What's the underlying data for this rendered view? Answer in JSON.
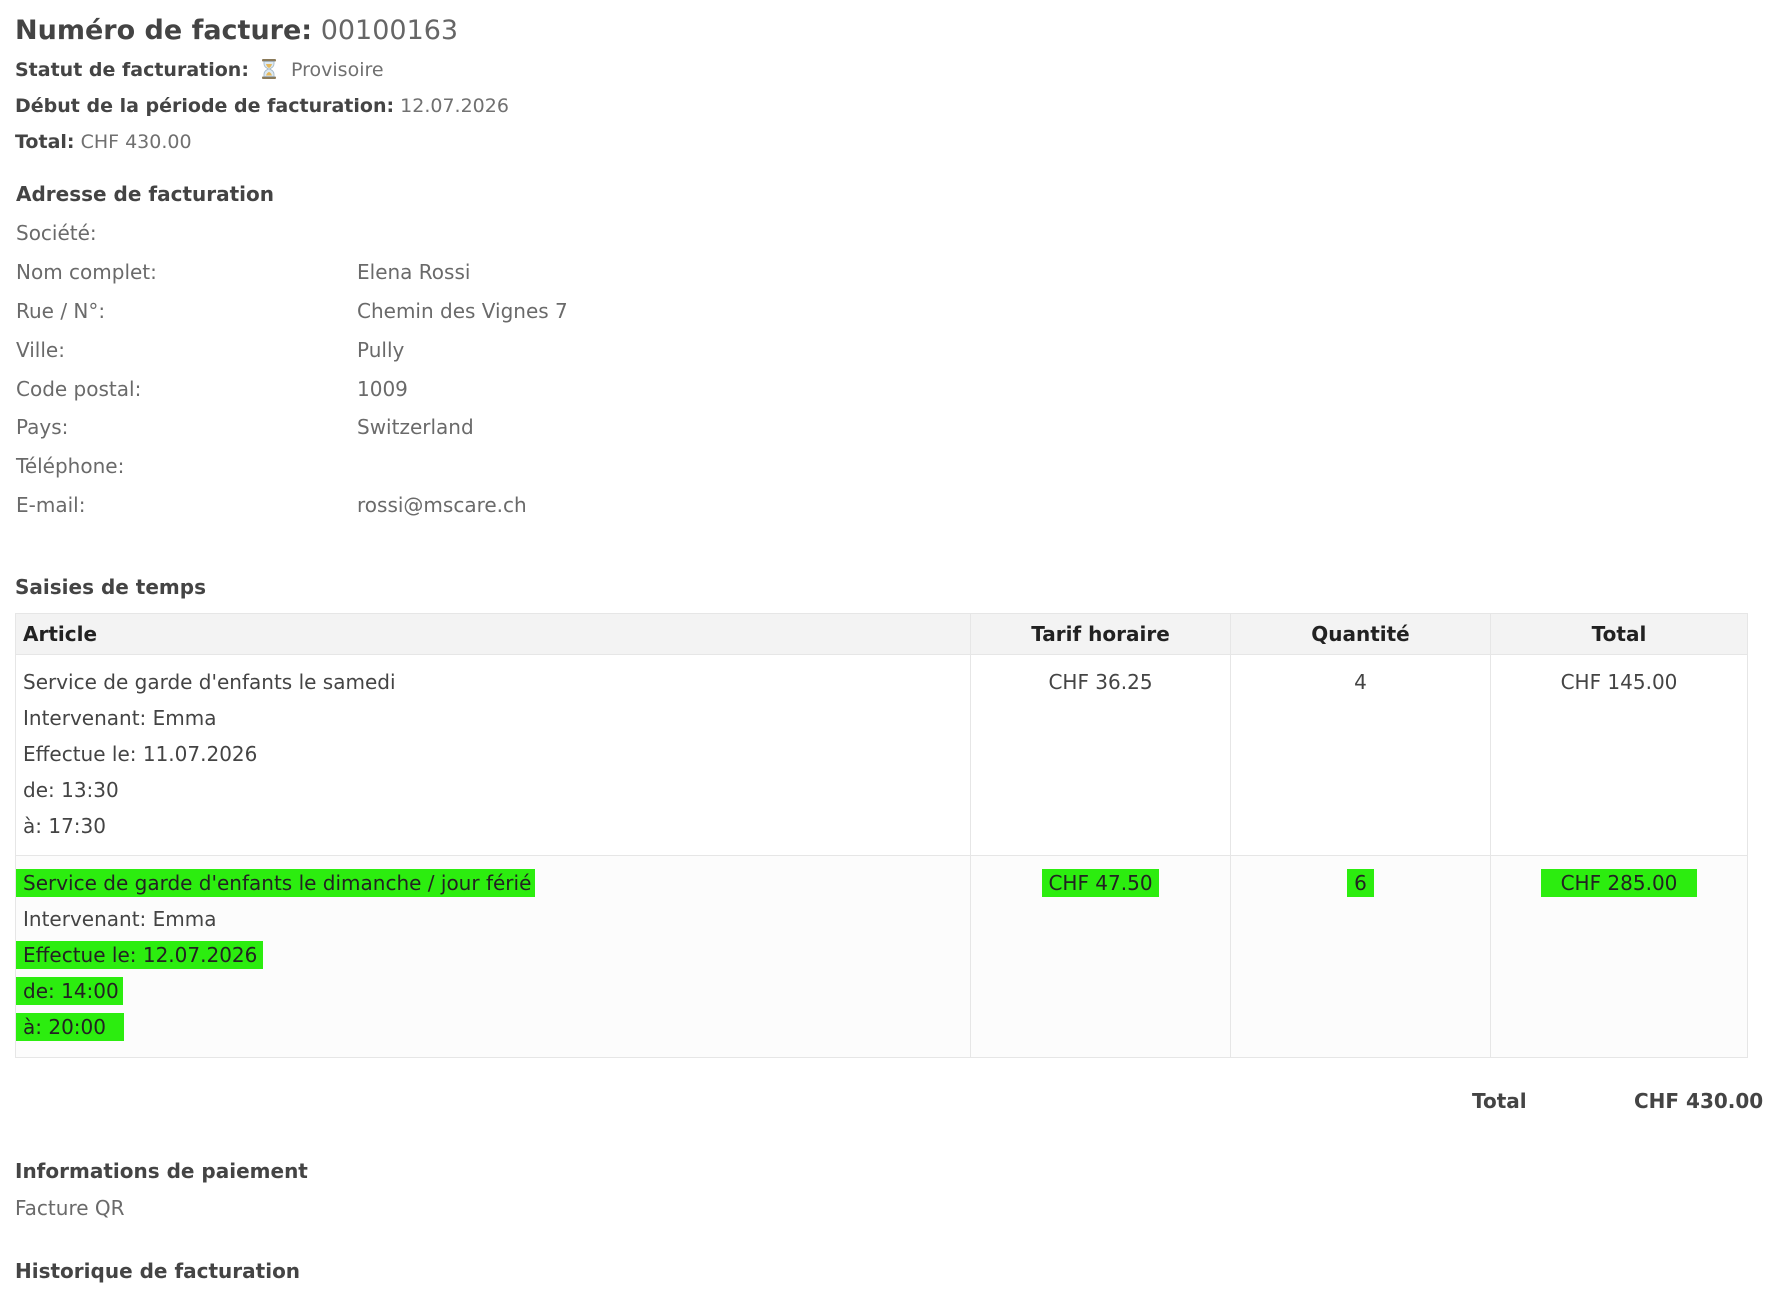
{
  "invoice": {
    "number_label": "Numéro de facture:",
    "number": "00100163",
    "status_label": "Statut de facturation:",
    "status": "Provisoire",
    "period_label": "Début de la période de facturation:",
    "period_start": "12.07.2026",
    "total_label": "Total:",
    "total": "CHF 430.00"
  },
  "address": {
    "heading": "Adresse de facturation",
    "rows": [
      {
        "label": "Société:",
        "value": ""
      },
      {
        "label": "Nom complet:",
        "value": "Elena Rossi"
      },
      {
        "label": "Rue / N°:",
        "value": "Chemin des Vignes 7"
      },
      {
        "label": "Ville:",
        "value": "Pully"
      },
      {
        "label": "Code postal:",
        "value": "1009"
      },
      {
        "label": "Pays:",
        "value": "Switzerland"
      },
      {
        "label": "Téléphone:",
        "value": ""
      },
      {
        "label": "E-mail:",
        "value": "rossi@mscare.ch"
      }
    ]
  },
  "time_entries": {
    "heading": "Saisies de temps",
    "columns": [
      "Article",
      "Tarif horaire",
      "Quantité",
      "Total"
    ],
    "rows": [
      {
        "article": "Service de garde d'enfants le samedi",
        "worker": "Intervenant: Emma",
        "date": "Effectue le: 11.07.2026",
        "from": "de: 13:30",
        "to": "à: 17:30",
        "rate": "CHF 36.25",
        "quantity": "4",
        "total": "CHF 145.00"
      },
      {
        "article": "Service de garde d'enfants le dimanche / jour férié",
        "worker": "Intervenant: Emma",
        "date": "Effectue le: 12.07.2026",
        "from": "de: 14:00",
        "to": "à: 20:00",
        "rate": "CHF 47.50",
        "quantity": "6",
        "total": "CHF 285.00"
      }
    ],
    "total_label": "Total",
    "total_value": "CHF 430.00"
  },
  "payment": {
    "heading": "Informations de paiement",
    "method": "Facture QR"
  },
  "history": {
    "heading": "Historique de facturation"
  },
  "colors": {
    "highlight": "#2ced0f"
  },
  "icons": {
    "status": "hourglass-icon"
  }
}
